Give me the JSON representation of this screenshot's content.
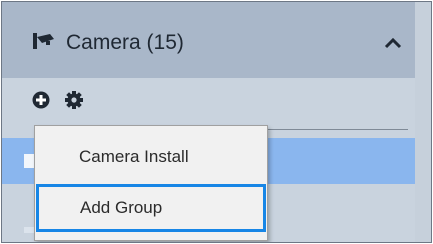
{
  "panel": {
    "title": "Camera (15)",
    "icon": "security-camera-icon",
    "collapse_icon": "chevron-up-icon"
  },
  "toolbar": {
    "add_icon": "add-circle-icon",
    "settings_icon": "gear-icon"
  },
  "context_menu": {
    "items": [
      {
        "label": "Camera Install"
      },
      {
        "label": "Add Group"
      }
    ],
    "focused_item": "Add Group"
  },
  "colors": {
    "header_bg": "#a9b7c9",
    "panel_bg": "#c9d3de",
    "selected_row": "#8ab6ee",
    "focus_border": "#1786e6",
    "menu_bg": "#f1f1f1"
  }
}
